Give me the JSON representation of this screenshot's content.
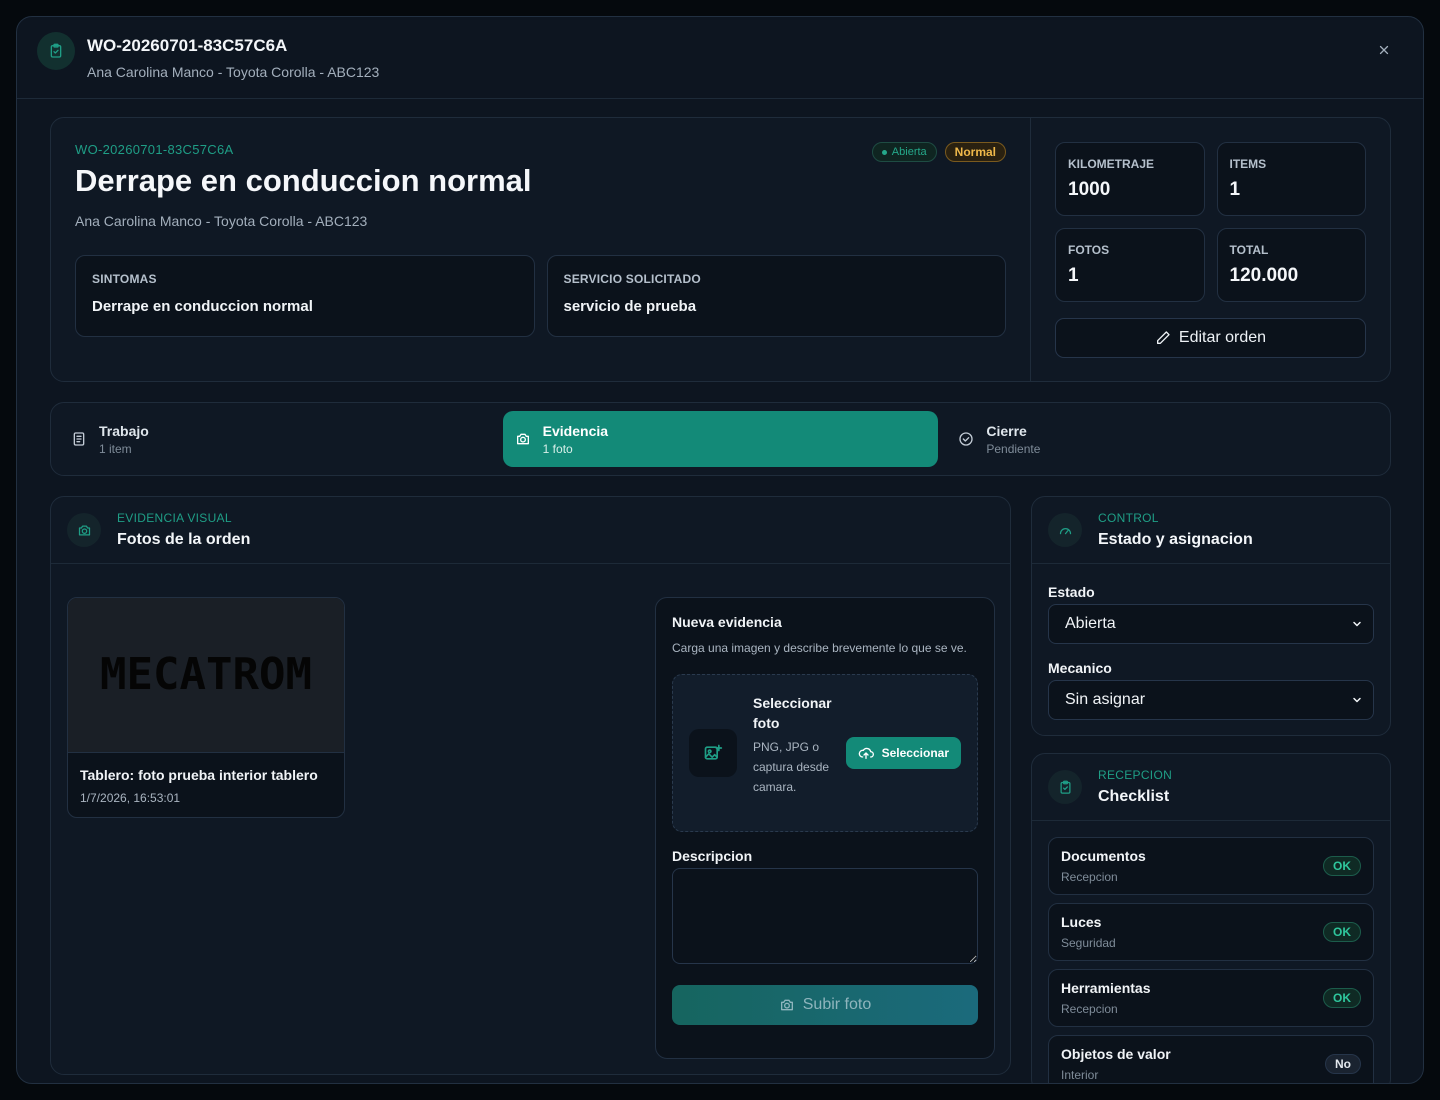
{
  "header": {
    "title": "WO-20260701-83C57C6A",
    "subtitle": "Ana Carolina Manco - Toyota Corolla - ABC123"
  },
  "summary": {
    "code": "WO-20260701-83C57C6A",
    "status_badge": "Abierta",
    "priority_badge": "Normal",
    "title": "Derrape en conduccion normal",
    "subtitle": "Ana Carolina Manco - Toyota Corolla - ABC123",
    "symptoms_label": "SINTOMAS",
    "symptoms_value": "Derrape en conduccion normal",
    "service_label": "SERVICIO SOLICITADO",
    "service_value": "servicio de prueba",
    "stats": [
      {
        "label": "KILOMETRAJE",
        "value": "1000"
      },
      {
        "label": "ITEMS",
        "value": "1"
      },
      {
        "label": "FOTOS",
        "value": "1"
      },
      {
        "label": "TOTAL",
        "value": "120.000"
      }
    ],
    "edit_label": "Editar orden"
  },
  "tabs": [
    {
      "name": "Trabajo",
      "meta": "1 item",
      "icon": "clipboard-list-icon",
      "active": false
    },
    {
      "name": "Evidencia",
      "meta": "1 foto",
      "icon": "camera-icon",
      "active": true
    },
    {
      "name": "Cierre",
      "meta": "Pendiente",
      "icon": "check-circle-icon",
      "active": false
    }
  ],
  "photos": {
    "eyebrow": "EVIDENCIA VISUAL",
    "title": "Fotos de la orden",
    "card": {
      "image_text": "MECATROM",
      "caption": "Tablero: foto prueba interior tablero",
      "date": "1/7/2026, 16:53:01"
    },
    "new_evidence": {
      "title": "Nueva evidencia",
      "subtitle": "Carga una imagen y describe brevemente lo que se ve.",
      "select_title": "Seleccionar foto",
      "select_desc": "PNG, JPG o captura desde camara.",
      "select_button": "Seleccionar",
      "description_label": "Descripcion",
      "upload_button": "Subir foto"
    }
  },
  "control": {
    "eyebrow": "CONTROL",
    "title": "Estado y asignacion",
    "estado_label": "Estado",
    "estado_value": "Abierta",
    "mecanico_label": "Mecanico",
    "mecanico_value": "Sin asignar"
  },
  "checklist": {
    "eyebrow": "RECEPCION",
    "title": "Checklist",
    "items": [
      {
        "name": "Documentos",
        "category": "Recepcion",
        "status": "OK"
      },
      {
        "name": "Luces",
        "category": "Seguridad",
        "status": "OK"
      },
      {
        "name": "Herramientas",
        "category": "Recepcion",
        "status": "OK"
      },
      {
        "name": "Objetos de valor",
        "category": "Interior",
        "status": "No"
      }
    ]
  },
  "colors": {
    "accent": "#138a78",
    "accent_text": "#1f9e86",
    "warning": "#f0b94a",
    "background": "#0d1520"
  }
}
